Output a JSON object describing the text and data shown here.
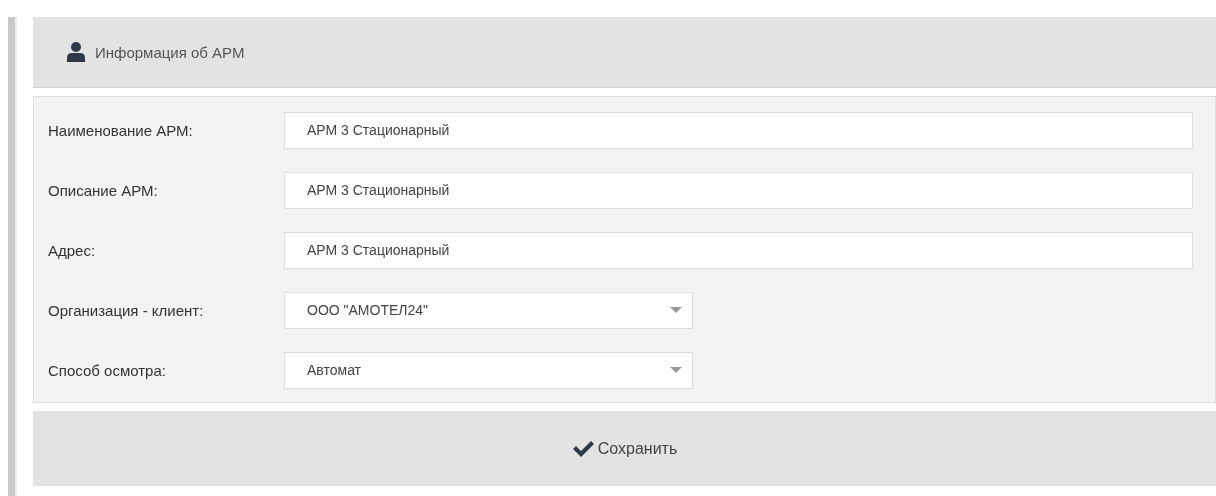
{
  "panel": {
    "title": "Информация об АРМ"
  },
  "fields": [
    {
      "kind": "text",
      "label": "Наименование АРМ:",
      "value": "АРМ 3 Стационарный"
    },
    {
      "kind": "text",
      "label": "Описание АРМ:",
      "value": "АРМ 3 Стационарный"
    },
    {
      "kind": "text",
      "label": "Адрес:",
      "value": "АРМ 3 Стационарный"
    },
    {
      "kind": "select",
      "label": "Организация - клиент:",
      "value": "ООО \"АМОТЕЛ24\""
    },
    {
      "kind": "select",
      "label": "Способ осмотра:",
      "value": "Автомат"
    }
  ],
  "save_button": {
    "label": "Сохранить"
  }
}
